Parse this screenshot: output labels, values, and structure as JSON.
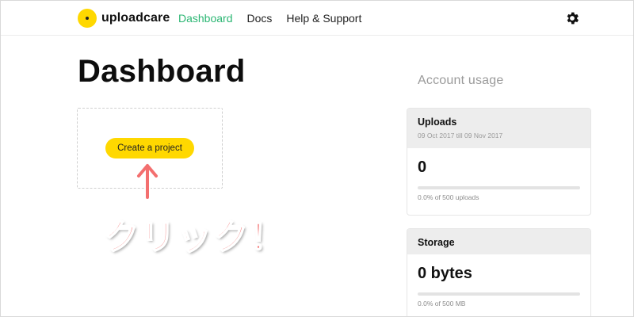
{
  "nav": {
    "logo_text": "uploadcare",
    "links": [
      "Dashboard",
      "Docs",
      "Help & Support"
    ],
    "active_index": 0,
    "settings_icon": "gear-icon"
  },
  "main": {
    "title": "Dashboard",
    "create_button_label": "Create a project"
  },
  "annotation": {
    "arrow": "↑",
    "text": "クリック！",
    "color": "#f36f6f"
  },
  "usage": {
    "title": "Account usage",
    "uploads": {
      "label": "Uploads",
      "period": "09 Oct 2017 till 09 Nov 2017",
      "value": "0",
      "note": "0.0% of 500 uploads",
      "progress": 0.0
    },
    "storage": {
      "label": "Storage",
      "value": "0 bytes",
      "note": "0.0% of 500 MB",
      "progress": 0.0
    }
  },
  "colors": {
    "brand_yellow": "#ffd800",
    "active_link": "#2bb673",
    "card_header": "#ededed"
  }
}
